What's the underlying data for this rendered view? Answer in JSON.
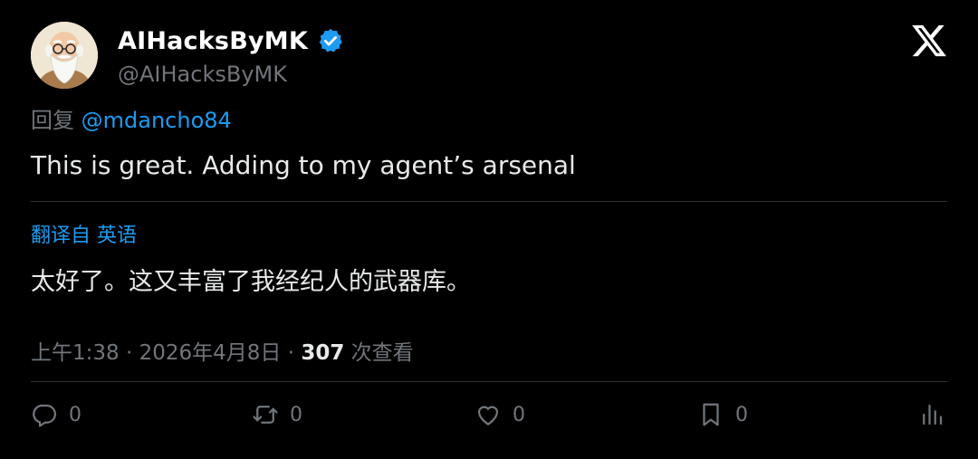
{
  "author": {
    "display_name": "AIHacksByMK",
    "handle": "@AIHacksByMK",
    "verified": true,
    "avatar": "bald-bearded-old-man-cartoon"
  },
  "reply": {
    "prefix": "回复",
    "mention": "@mdancho84"
  },
  "tweet": {
    "text": "This is great. Adding to my agent’s arsenal"
  },
  "translation": {
    "label": "翻译自 英语",
    "text": "太好了。这又丰富了我经纪人的武器库。"
  },
  "meta": {
    "time": "上午1:38",
    "separator": "·",
    "date": "2026年4月8日",
    "views": "307",
    "views_label": "次查看"
  },
  "actions": {
    "replies": "0",
    "reposts": "0",
    "likes": "0",
    "bookmarks": "0"
  },
  "icons": {
    "brand": "x-logo-icon",
    "verified": "verified-badge-icon",
    "reply": "reply-icon",
    "repost": "repost-icon",
    "like": "heart-icon",
    "bookmark": "bookmark-icon",
    "stats": "analytics-icon"
  },
  "colors": {
    "background": "#000000",
    "text": "#e7e9ea",
    "muted": "#71767b",
    "accent": "#1d9bf0",
    "divider": "#2f3336"
  }
}
